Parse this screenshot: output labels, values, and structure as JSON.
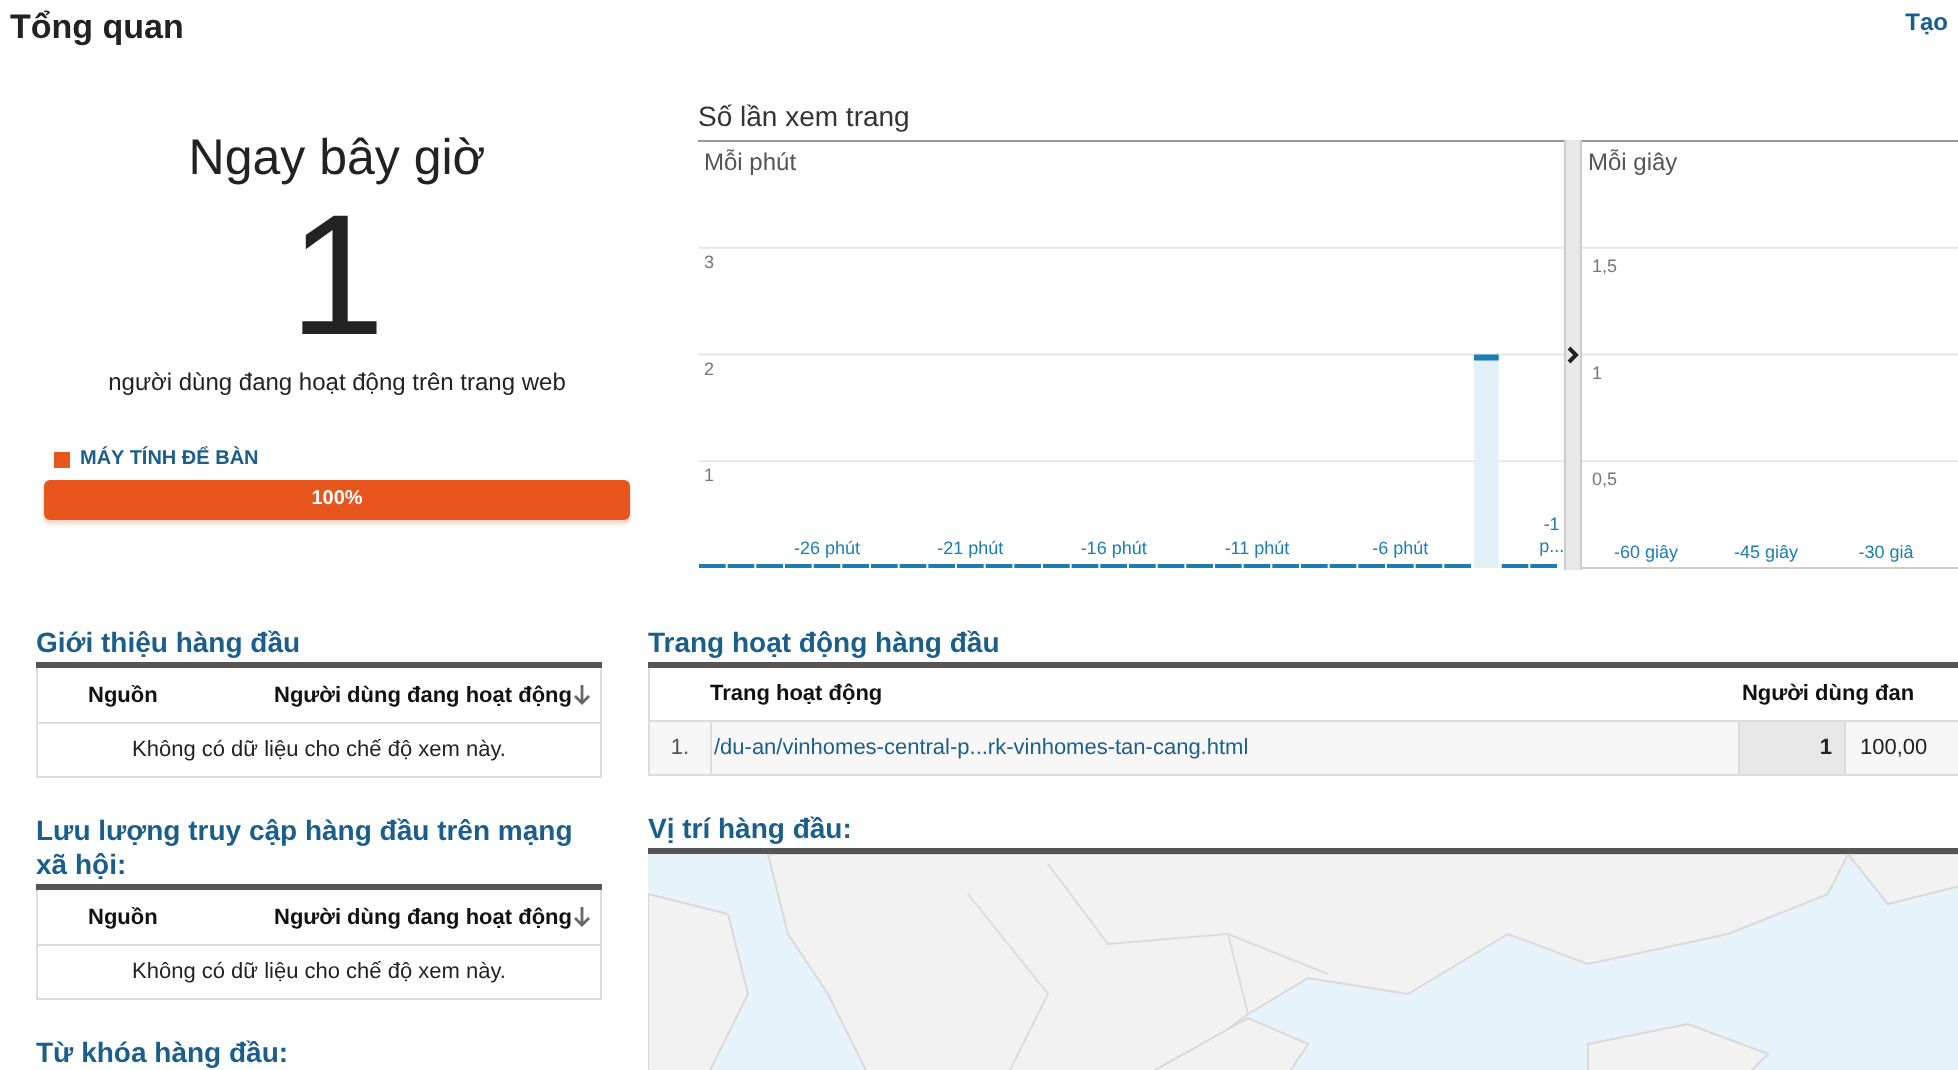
{
  "header": {
    "title": "Tổng quan",
    "action": "Tạo"
  },
  "right_now": {
    "title": "Ngay bây giờ",
    "count": "1",
    "caption": "người dùng đang hoạt động trên trang web",
    "devices": [
      {
        "label": "MÁY TÍNH ĐỂ BÀN",
        "color": "#e8561e",
        "level": 1,
        "percent": "100%"
      }
    ]
  },
  "pageviews": {
    "title": "Số lần xem trang",
    "per_minute": {
      "label": "Mỗi phút",
      "chart_data": {
        "type": "bar",
        "x": [
          -30,
          -29,
          -28,
          -27,
          -26,
          -25,
          -24,
          -23,
          -22,
          -21,
          -20,
          -19,
          -18,
          -17,
          -16,
          -15,
          -14,
          -13,
          -12,
          -11,
          -10,
          -9,
          -8,
          -7,
          -6,
          -5,
          -4,
          -3,
          -2,
          -1
        ],
        "values": [
          0,
          0,
          0,
          0,
          0,
          0,
          0,
          0,
          0,
          0,
          0,
          0,
          0,
          0,
          0,
          0,
          0,
          0,
          0,
          0,
          0,
          0,
          0,
          0,
          0,
          0,
          0,
          2,
          0,
          0
        ],
        "xlim": [
          -30.5,
          -0.5
        ],
        "ylim": [
          0,
          4
        ],
        "grid": true,
        "yticks": [
          1,
          2,
          3
        ],
        "xticks": [
          {
            "value": -26,
            "label": "-26 phút"
          },
          {
            "value": -21,
            "label": "-21 phút"
          },
          {
            "value": -16,
            "label": "-16 phút"
          },
          {
            "value": -11,
            "label": "-11 phút"
          },
          {
            "value": -6,
            "label": "-6 phút"
          },
          {
            "value": -1,
            "label": "-1 p..."
          }
        ]
      }
    },
    "per_second": {
      "label": "Mỗi giây",
      "chart_data": {
        "type": "bar",
        "xlim": [
          -68,
          2
        ],
        "ylim": [
          0,
          2
        ],
        "grid": true,
        "yticks": [
          {
            "value": 0.5,
            "label": "0,5"
          },
          {
            "value": 1,
            "label": "1"
          },
          {
            "value": 1.5,
            "label": "1,5"
          }
        ],
        "xticks": [
          {
            "value": -60,
            "label": "-60 giây"
          },
          {
            "value": -45,
            "label": "-45 giây"
          },
          {
            "value": -30,
            "label": "-30 giâ"
          }
        ]
      }
    }
  },
  "top_referrals": {
    "title": "Giới thiệu hàng đầu",
    "columns": [
      "Nguồn",
      "Người dùng đang hoạt động"
    ],
    "empty": "Không có dữ liệu cho chế độ xem này."
  },
  "top_social": {
    "title": "Lưu lượng truy cập hàng đầu trên mạng xã hội:",
    "columns": [
      "Nguồn",
      "Người dùng đang hoạt động"
    ],
    "empty": "Không có dữ liệu cho chế độ xem này."
  },
  "top_keywords": {
    "title": "Từ khóa hàng đầu:"
  },
  "top_pages": {
    "title": "Trang hoạt động hàng đầu",
    "columns": [
      "Trang hoạt động",
      "Người dùng đan"
    ],
    "rows": [
      {
        "index": "1.",
        "page": "/du-an/vinhomes-central-p...rk-vinhomes-tan-cang.html",
        "users": "1",
        "share": "100,00"
      }
    ]
  },
  "top_locations": {
    "title": "Vị trí hàng đầu:"
  }
}
